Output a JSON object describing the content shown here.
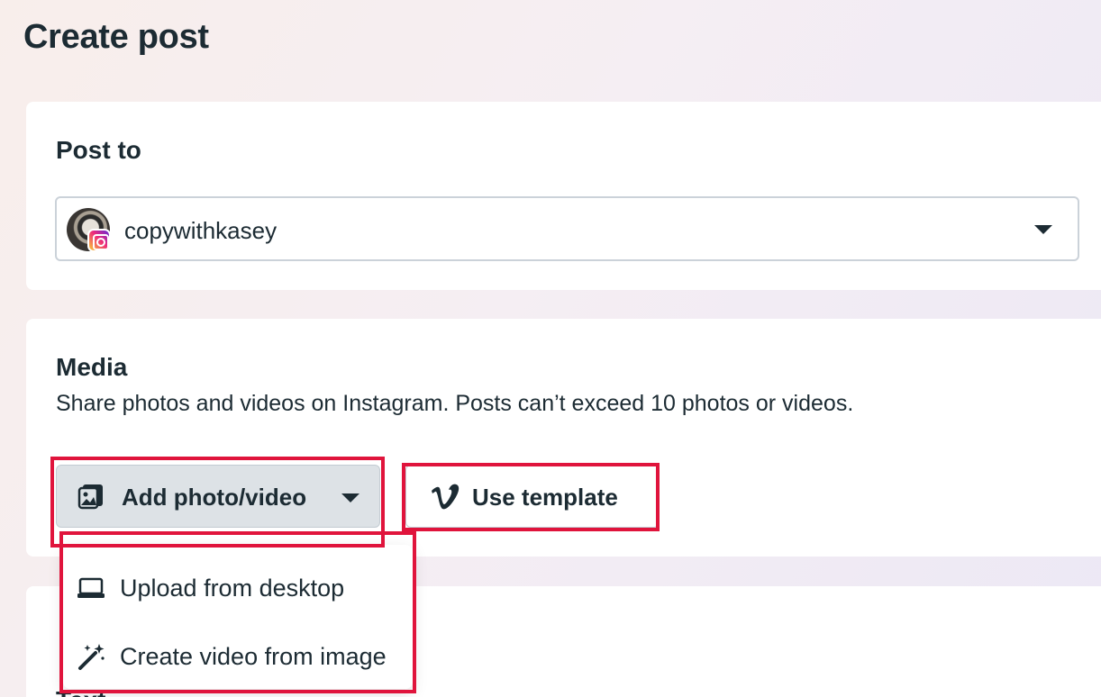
{
  "page": {
    "title": "Create post"
  },
  "post_to": {
    "title": "Post to",
    "selected_account": "copywithkasey",
    "avatar_icon": "profile-avatar",
    "badge_icon": "instagram-icon"
  },
  "media": {
    "title": "Media",
    "description": "Share photos and videos on Instagram. Posts can’t exceed 10 photos or videos.",
    "add_button": {
      "label": "Add photo/video",
      "icon": "photo-icon"
    },
    "template_button": {
      "label": "Use template",
      "icon": "vimeo-icon"
    },
    "dropdown": {
      "items": [
        {
          "label": "Upload from desktop",
          "icon": "laptop-icon"
        },
        {
          "label": "Create video from image",
          "icon": "magic-wand-icon"
        }
      ]
    }
  },
  "next_section": {
    "title_partial": "Text"
  },
  "colors": {
    "highlight": "#e0143c",
    "text": "#1c2b33",
    "button_gray": "#dde2e6"
  }
}
